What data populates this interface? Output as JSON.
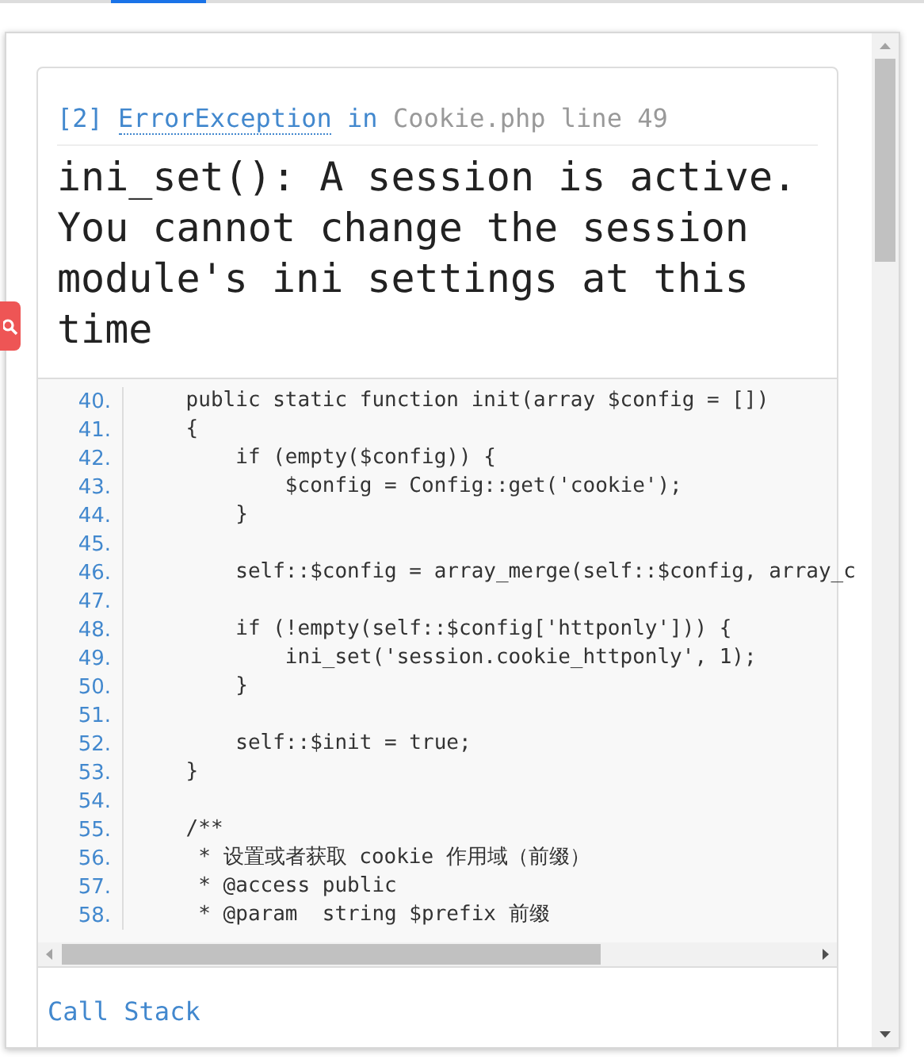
{
  "error_header": {
    "code": "[2]",
    "exception": "ErrorException",
    "connector": "in",
    "location": "Cookie.php line 49"
  },
  "message": "ini_set(): A session is active. You cannot change the session module's ini settings at this time",
  "code_lines": [
    {
      "number": "40.",
      "text": "    public static function init(array $config = [])"
    },
    {
      "number": "41.",
      "text": "    {"
    },
    {
      "number": "42.",
      "text": "        if (empty($config)) {"
    },
    {
      "number": "43.",
      "text": "            $config = Config::get('cookie');"
    },
    {
      "number": "44.",
      "text": "        }"
    },
    {
      "number": "45."
    },
    {
      "number": "46.",
      "text": "        self::$config = array_merge(self::$config, array_c"
    },
    {
      "number": "47."
    },
    {
      "number": "48.",
      "text": "        if (!empty(self::$config['httponly'])) {"
    },
    {
      "number": "49.",
      "text": "            ini_set('session.cookie_httponly', 1);"
    },
    {
      "number": "50.",
      "text": "        }"
    },
    {
      "number": "51."
    },
    {
      "number": "52.",
      "text": "        self::$init = true;"
    },
    {
      "number": "53.",
      "text": "    }"
    },
    {
      "number": "54."
    },
    {
      "number": "55.",
      "text": "    /**"
    },
    {
      "number": "56.",
      "text": "     * 设置或者获取 cookie 作用域（前缀）"
    },
    {
      "number": "57.",
      "text": "     * @access public"
    },
    {
      "number": "58.",
      "text": "     * @param  string $prefix 前缀"
    }
  ],
  "section_title": "Call Stack"
}
